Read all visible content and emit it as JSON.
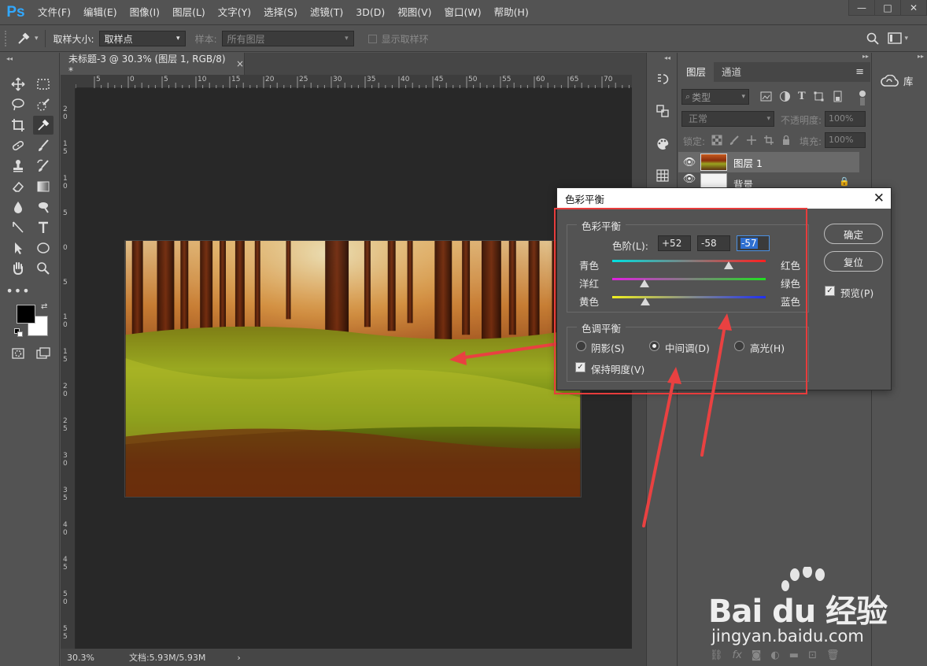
{
  "app": {
    "logo": "Ps"
  },
  "menu": [
    "文件(F)",
    "编辑(E)",
    "图像(I)",
    "图层(L)",
    "文字(Y)",
    "选择(S)",
    "滤镜(T)",
    "3D(D)",
    "视图(V)",
    "窗口(W)",
    "帮助(H)"
  ],
  "window_controls": [
    "—",
    "□",
    "✕"
  ],
  "options": {
    "sample_size_label": "取样大小:",
    "sample_size_value": "取样点",
    "sample_label": "样本:",
    "sample_value": "所有图层",
    "show_ring_label": "显示取样环"
  },
  "document": {
    "tab_title": "未标题-3 @ 30.3% (图层 1, RGB/8) *",
    "close_glyph": "×",
    "ruler_top": [
      "5",
      "0",
      "5",
      "10",
      "15",
      "20",
      "25",
      "30",
      "35",
      "40",
      "45",
      "50",
      "55",
      "60",
      "65",
      "70"
    ],
    "ruler_left": [
      "2\n0",
      "1\n5",
      "1\n0",
      "5",
      "0",
      "5",
      "1\n0",
      "1\n5",
      "2\n0",
      "2\n5",
      "3\n0",
      "3\n5",
      "4\n0",
      "4\n5",
      "5\n0",
      "5\n5"
    ],
    "zoom": "30.3%",
    "doc_size": "文档:5.93M/5.93M",
    "status_arrow": "›"
  },
  "layers_panel": {
    "tabs": [
      "图层",
      "通道"
    ],
    "filter_label": "类型",
    "blend_mode": "正常",
    "opacity_label": "不透明度:",
    "opacity_value": "100%",
    "lock_label": "锁定:",
    "fill_label": "填充:",
    "fill_value": "100%",
    "layers": [
      {
        "name": "图层 1",
        "selected": true
      },
      {
        "name": "背景",
        "selected": false
      }
    ]
  },
  "library_panel": {
    "label": "库"
  },
  "dialog": {
    "title": "色彩平衡",
    "close_glyph": "✕",
    "balance_group_title": "色彩平衡",
    "levels_label": "色阶(L):",
    "levels": [
      "+52",
      "-58",
      "-57"
    ],
    "sliders": [
      {
        "left": "青色",
        "right": "红色",
        "value": 52
      },
      {
        "left": "洋红",
        "right": "绿色",
        "value": -58
      },
      {
        "left": "黄色",
        "right": "蓝色",
        "value": -57
      }
    ],
    "tone_group_title": "色调平衡",
    "tones": [
      "阴影(S)",
      "中间调(D)",
      "高光(H)"
    ],
    "selected_tone": "中间调(D)",
    "preserve_luminosity": "保持明度(V)",
    "ok_button": "确定",
    "reset_button": "复位",
    "preview_label": "预览(P)"
  },
  "watermark": {
    "brand": "Bai du 经验",
    "url": "jingyan.baidu.com"
  },
  "colors": {
    "highlight": "#e73c3c",
    "arrow": "#e94141",
    "ps_blue": "#31a8ff"
  }
}
